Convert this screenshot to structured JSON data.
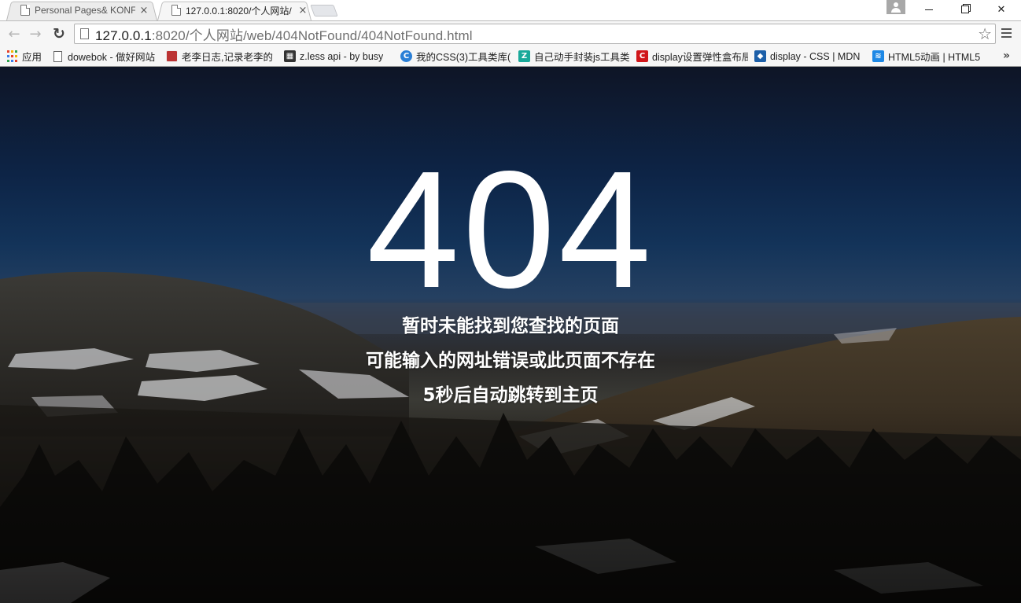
{
  "browser": {
    "tabs": [
      {
        "title": "Personal Pages& KONFO",
        "active": false
      },
      {
        "title": "127.0.0.1:8020/个人网站/",
        "active": true
      }
    ],
    "tab_close_glyph": "×",
    "address": {
      "host": "127.0.0.1",
      "path": ":8020/个人网站/web/404NotFound/404NotFound.html"
    },
    "nav": {
      "back": "←",
      "forward": "→",
      "reload": "↻"
    },
    "star_glyph": "☆",
    "window_controls": {
      "close": "✕"
    },
    "bookmarks": [
      {
        "label": "应用",
        "icon": "apps-grid-icon"
      },
      {
        "label": "dowebok - 做好网站",
        "icon": "page-icon"
      },
      {
        "label": "老李日志,记录老李的",
        "icon": "book-icon"
      },
      {
        "label": "z.less api - by busy",
        "icon": "zless-icon"
      },
      {
        "label": "我的CSS(3)工具类库(",
        "icon": "blue-c-icon"
      },
      {
        "label": "自己动手封装js工具类",
        "icon": "teal-icon"
      },
      {
        "label": "display设置弹性盒布局",
        "icon": "red-c-icon"
      },
      {
        "label": "display - CSS | MDN",
        "icon": "mdn-icon"
      },
      {
        "label": "HTML5动画 | HTML5",
        "icon": "wifi-icon"
      }
    ],
    "bookmarks_more": "»"
  },
  "page": {
    "code": "404",
    "line1": "暂时未能找到您查找的页面",
    "line2": "可能输入的网址错误或此页面不存在",
    "line3": "5秒后自动跳转到主页"
  },
  "colors": {
    "sky_top": "#0e1526",
    "sky_mid": "#133359",
    "text": "#ffffff"
  }
}
